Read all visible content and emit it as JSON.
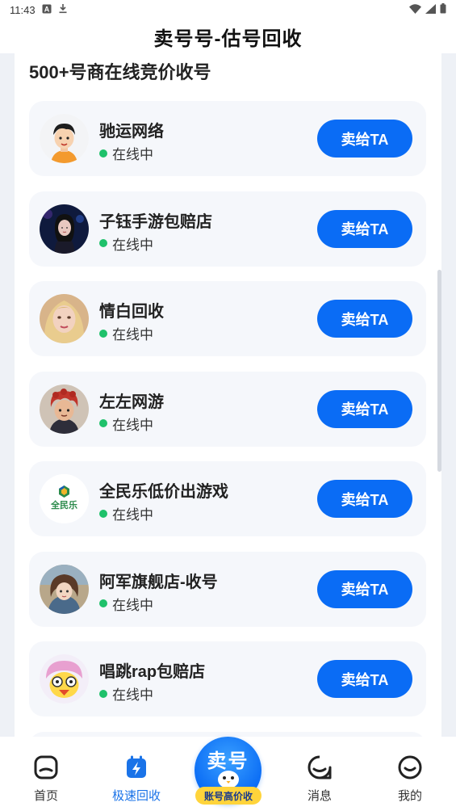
{
  "status_bar": {
    "time": "11:43",
    "icons": [
      "notification-a-icon",
      "download-icon",
      "wifi-icon",
      "signal-icon",
      "battery-icon"
    ]
  },
  "header": {
    "title": "卖号号-估号回收"
  },
  "section_title": "500+号商在线竞价收号",
  "merchants": [
    {
      "name": "驰运网络",
      "status": "在线中",
      "button": "卖给TA",
      "avatar": "cartoon-man-avatar"
    },
    {
      "name": "子钰手游包赔店",
      "status": "在线中",
      "button": "卖给TA",
      "avatar": "girl-photo-avatar"
    },
    {
      "name": "情白回收",
      "status": "在线中",
      "button": "卖给TA",
      "avatar": "blonde-girl-avatar"
    },
    {
      "name": "左左网游",
      "status": "在线中",
      "button": "卖给TA",
      "avatar": "red-hair-character-avatar"
    },
    {
      "name": "全民乐低价出游戏",
      "status": "在线中",
      "button": "卖给TA",
      "avatar": "quanminle-logo-avatar"
    },
    {
      "name": "阿军旗舰店-收号",
      "status": "在线中",
      "button": "卖给TA",
      "avatar": "anime-girl-avatar"
    },
    {
      "name": "唱跳rap包赔店",
      "status": "在线中",
      "button": "卖给TA",
      "avatar": "chick-cartoon-avatar"
    }
  ],
  "bottom_nav": {
    "items": [
      {
        "label": "首页",
        "icon": "home-icon",
        "active": false
      },
      {
        "label": "极速回收",
        "icon": "fast-recycle-icon",
        "active": true
      },
      {
        "label": "消息",
        "icon": "message-icon",
        "active": false
      },
      {
        "label": "我的",
        "icon": "profile-icon",
        "active": false
      }
    ],
    "center": {
      "title": "卖号",
      "tag": "账号高价收"
    }
  },
  "colors": {
    "primary": "#0a6cf5",
    "online_dot": "#1fc16b",
    "active_nav": "#1a73e8",
    "tag_yellow": "#ffd43b"
  }
}
